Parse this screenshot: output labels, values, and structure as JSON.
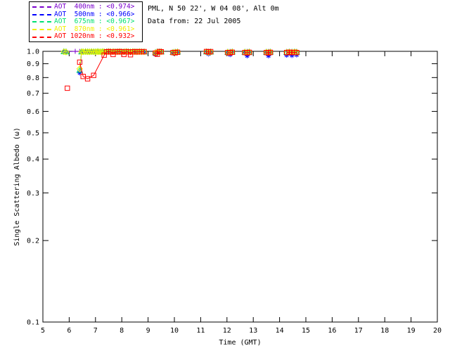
{
  "header": {
    "site_line": "PML, N 50 22', W 04 08', Alt 0m",
    "date_line": "Data from: 22 Jul 2005"
  },
  "chart_data": {
    "type": "scatter",
    "title": "",
    "xlabel": "Time (GMT)",
    "ylabel": "Single Scattering Albedo (ω)",
    "xlim": [
      5,
      20
    ],
    "ylim": [
      0.1,
      1.0
    ],
    "yscale": "log",
    "grid": false,
    "legend_position": "top-left-outside",
    "xticks": [
      5,
      6,
      7,
      8,
      9,
      10,
      11,
      12,
      13,
      14,
      15,
      16,
      17,
      18,
      19,
      20
    ],
    "yticks": [
      1.0,
      0.9,
      0.8,
      0.7,
      0.6,
      0.5,
      0.4,
      0.3,
      0.2,
      0.1
    ],
    "axis_color": "#000000",
    "background_color": "#ffffff",
    "times": [
      5.8,
      5.88,
      5.93,
      6.23,
      6.4,
      6.47,
      6.53,
      6.62,
      6.7,
      6.77,
      6.85,
      6.93,
      7.0,
      7.07,
      7.13,
      7.2,
      7.27,
      7.33,
      7.42,
      7.5,
      7.58,
      7.67,
      7.75,
      7.83,
      7.92,
      8.0,
      8.08,
      8.17,
      8.25,
      8.33,
      8.42,
      8.5,
      8.58,
      8.67,
      8.75,
      8.85,
      9.28,
      9.35,
      9.43,
      9.5,
      9.95,
      10.03,
      10.12,
      11.22,
      11.3,
      11.38,
      12.03,
      12.12,
      12.2,
      12.68,
      12.77,
      12.85,
      13.5,
      13.58,
      13.65,
      14.27,
      14.37,
      14.47,
      14.57,
      14.65
    ],
    "series": [
      {
        "name": "AOT 400nm",
        "legend_label": "AOT  400nm : <0.974>",
        "mean": 0.974,
        "color": "#7A00CC",
        "marker": "plus",
        "values": [
          0.999,
          0.997,
          null,
          1.0,
          0.999,
          1.0,
          0.998,
          1.0,
          0.999,
          0.998,
          1.0,
          0.999,
          1.0,
          0.998,
          1.0,
          0.999,
          1.0,
          0.998,
          1.0,
          0.999,
          0.998,
          1.0,
          0.999,
          1.0,
          0.998,
          1.0,
          0.999,
          1.0,
          0.998,
          1.0,
          0.999,
          1.0,
          0.998,
          1.0,
          0.999,
          1.0,
          0.998,
          1.0,
          0.999,
          1.0,
          0.997,
          0.999,
          1.0,
          0.999,
          1.0,
          0.998,
          0.997,
          0.999,
          1.0,
          0.998,
          0.999,
          1.0,
          0.998,
          0.999,
          1.0,
          0.998,
          1.0,
          0.999,
          1.0,
          0.999
        ]
      },
      {
        "name": "AOT 500nm",
        "legend_label": "AOT  500nm : <0.966>",
        "mean": 0.966,
        "color": "#0000FF",
        "marker": "asterisk",
        "values": [
          0.996,
          0.995,
          null,
          null,
          0.832,
          0.995,
          0.994,
          0.996,
          0.995,
          0.994,
          0.996,
          0.995,
          0.994,
          0.996,
          0.995,
          0.994,
          0.996,
          0.995,
          0.994,
          0.996,
          0.995,
          0.996,
          0.994,
          0.995,
          0.996,
          0.994,
          0.995,
          0.996,
          0.995,
          0.994,
          0.996,
          0.995,
          0.994,
          0.996,
          0.995,
          0.994,
          0.975,
          0.99,
          0.992,
          0.995,
          0.985,
          0.99,
          0.988,
          0.995,
          0.978,
          0.99,
          0.993,
          0.972,
          0.99,
          0.991,
          0.962,
          0.99,
          0.992,
          0.962,
          0.99,
          0.967,
          0.99,
          0.965,
          0.991,
          0.97
        ]
      },
      {
        "name": "AOT 675nm",
        "legend_label": "AOT  675nm : <0.967>",
        "mean": 0.967,
        "color": "#00E070",
        "marker": "triangle",
        "values": [
          0.998,
          0.997,
          null,
          null,
          0.852,
          0.997,
          0.996,
          0.998,
          0.997,
          0.996,
          0.998,
          0.997,
          0.996,
          0.998,
          0.997,
          0.996,
          0.998,
          0.997,
          0.996,
          0.998,
          0.997,
          0.998,
          0.996,
          0.997,
          0.998,
          0.996,
          0.997,
          0.998,
          0.997,
          0.996,
          0.998,
          0.997,
          0.996,
          0.998,
          0.997,
          0.996,
          0.99,
          0.995,
          0.996,
          0.997,
          0.992,
          0.994,
          0.996,
          0.997,
          0.993,
          0.996,
          0.994,
          0.992,
          0.996,
          0.994,
          0.992,
          0.995,
          0.994,
          0.992,
          0.995,
          0.993,
          0.995,
          0.994,
          0.996,
          0.994
        ]
      },
      {
        "name": "AOT 870nm",
        "legend_label": "AOT  870nm : <0.961>",
        "mean": 0.961,
        "color": "#F0F000",
        "marker": "diamond",
        "values": [
          0.996,
          0.994,
          null,
          null,
          0.862,
          0.996,
          0.995,
          0.997,
          0.996,
          0.995,
          0.997,
          0.996,
          0.995,
          0.997,
          0.996,
          0.995,
          0.997,
          0.996,
          0.995,
          0.997,
          0.996,
          0.997,
          0.995,
          0.996,
          0.997,
          0.995,
          0.996,
          0.997,
          0.996,
          0.995,
          0.997,
          0.996,
          0.995,
          0.997,
          0.996,
          0.995,
          0.988,
          0.993,
          0.995,
          0.996,
          0.99,
          0.993,
          0.994,
          0.996,
          0.991,
          0.994,
          0.992,
          0.99,
          0.994,
          0.992,
          0.99,
          0.993,
          0.992,
          0.99,
          0.993,
          0.991,
          0.993,
          0.992,
          0.994,
          0.992
        ]
      },
      {
        "name": "AOT 1020nm",
        "legend_label": "AOT 1020nm : <0.932>",
        "mean": 0.932,
        "color": "#FF0000",
        "marker": "square",
        "values": [
          null,
          null,
          0.731,
          null,
          0.912,
          null,
          0.808,
          null,
          0.792,
          null,
          null,
          0.815,
          null,
          null,
          null,
          null,
          null,
          0.968,
          0.996,
          0.998,
          0.995,
          0.974,
          0.997,
          0.995,
          0.998,
          0.996,
          0.974,
          0.997,
          0.995,
          0.972,
          0.996,
          0.997,
          0.995,
          0.997,
          0.996,
          0.997,
          0.985,
          0.975,
          0.998,
          0.996,
          0.99,
          0.988,
          0.992,
          0.998,
          0.995,
          0.997,
          0.99,
          0.987,
          0.992,
          0.99,
          0.988,
          0.991,
          0.99,
          0.988,
          0.991,
          0.99,
          0.992,
          0.99,
          0.991,
          0.99
        ]
      }
    ]
  }
}
